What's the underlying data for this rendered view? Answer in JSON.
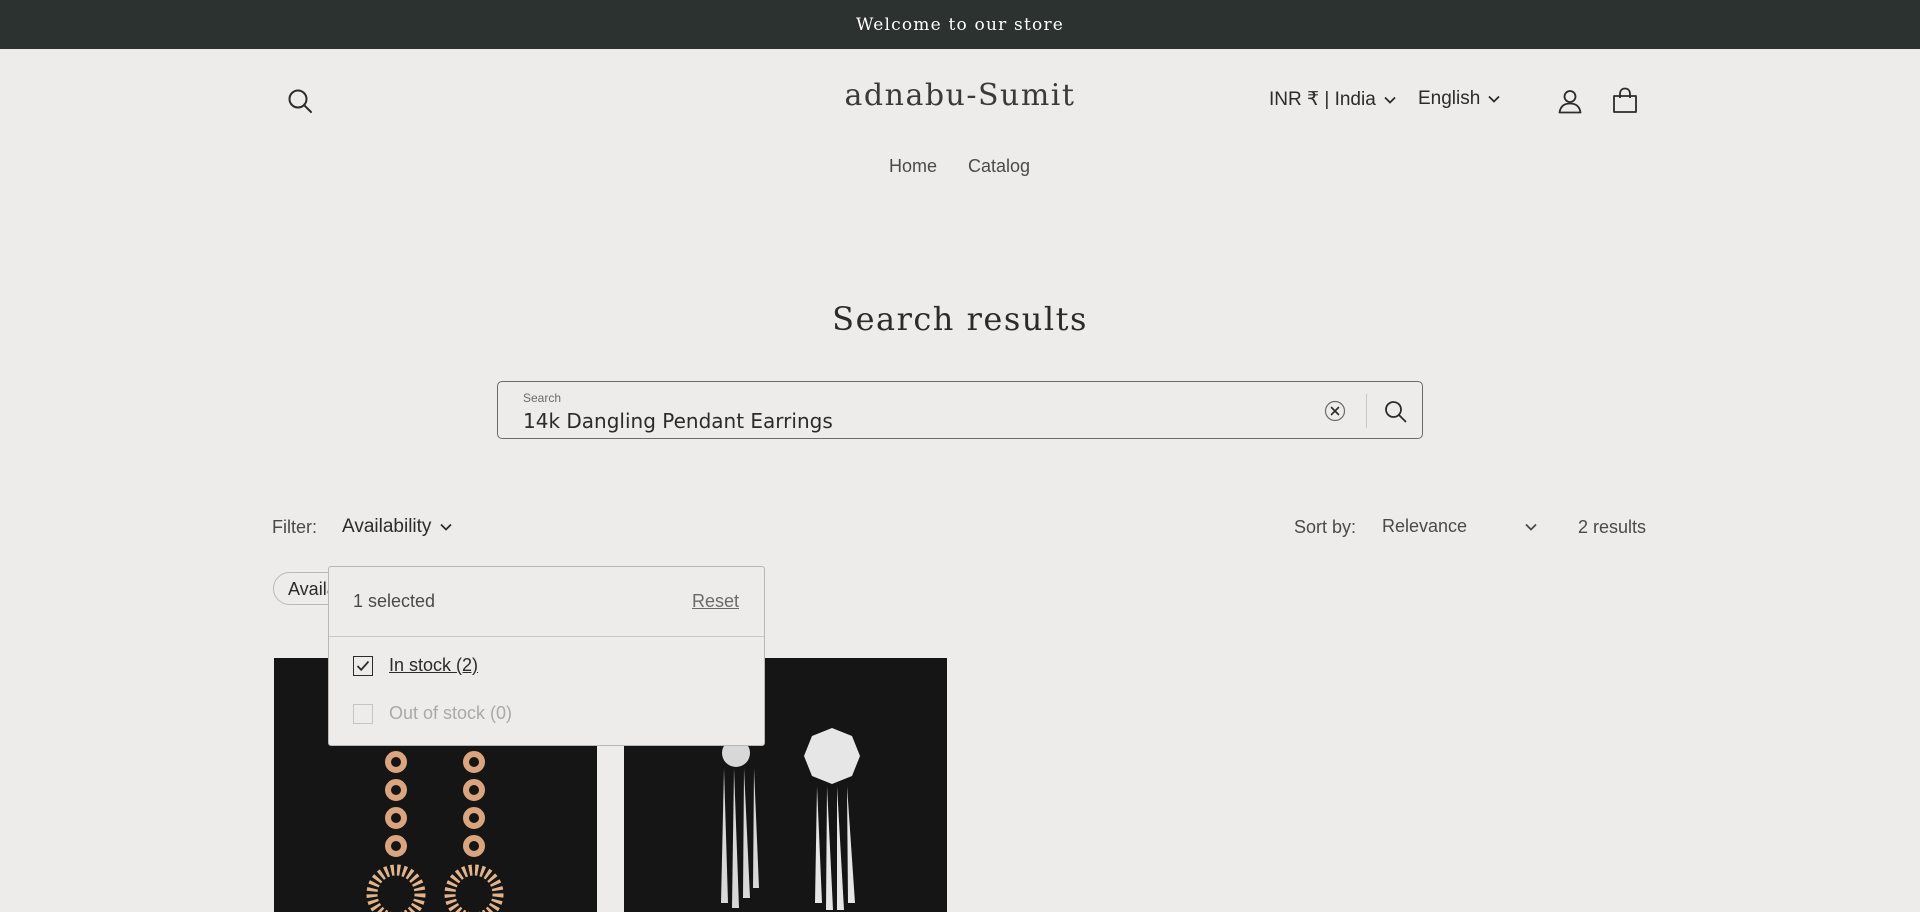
{
  "announcement": "Welcome to our store",
  "header": {
    "logo": "adnabu-Sumit",
    "country": "INR ₹ | India",
    "language": "English",
    "nav": [
      "Home",
      "Catalog"
    ]
  },
  "page_title": "Search results",
  "search": {
    "label": "Search",
    "value": "14k Dangling Pendant Earrings"
  },
  "toolbar": {
    "filter_label": "Filter:",
    "filter_name": "Availability",
    "sort_label": "Sort by:",
    "sort_value": "Relevance",
    "result_count": "2 results"
  },
  "active_filter_pill": "Availability",
  "availability_panel": {
    "selected_text": "1 selected",
    "reset_label": "Reset",
    "options": [
      {
        "label": "In stock (2)",
        "checked": true,
        "disabled": false
      },
      {
        "label": "Out of stock (0)",
        "checked": false,
        "disabled": true
      }
    ]
  },
  "products": [
    {
      "image": "rose-gold-chain-link-earrings"
    },
    {
      "image": "diamond-dangling-pendant-earrings"
    }
  ],
  "colors": {
    "announcement_bg": "#2c3230",
    "page_bg": "#edeceb",
    "card_bg": "#151515"
  }
}
